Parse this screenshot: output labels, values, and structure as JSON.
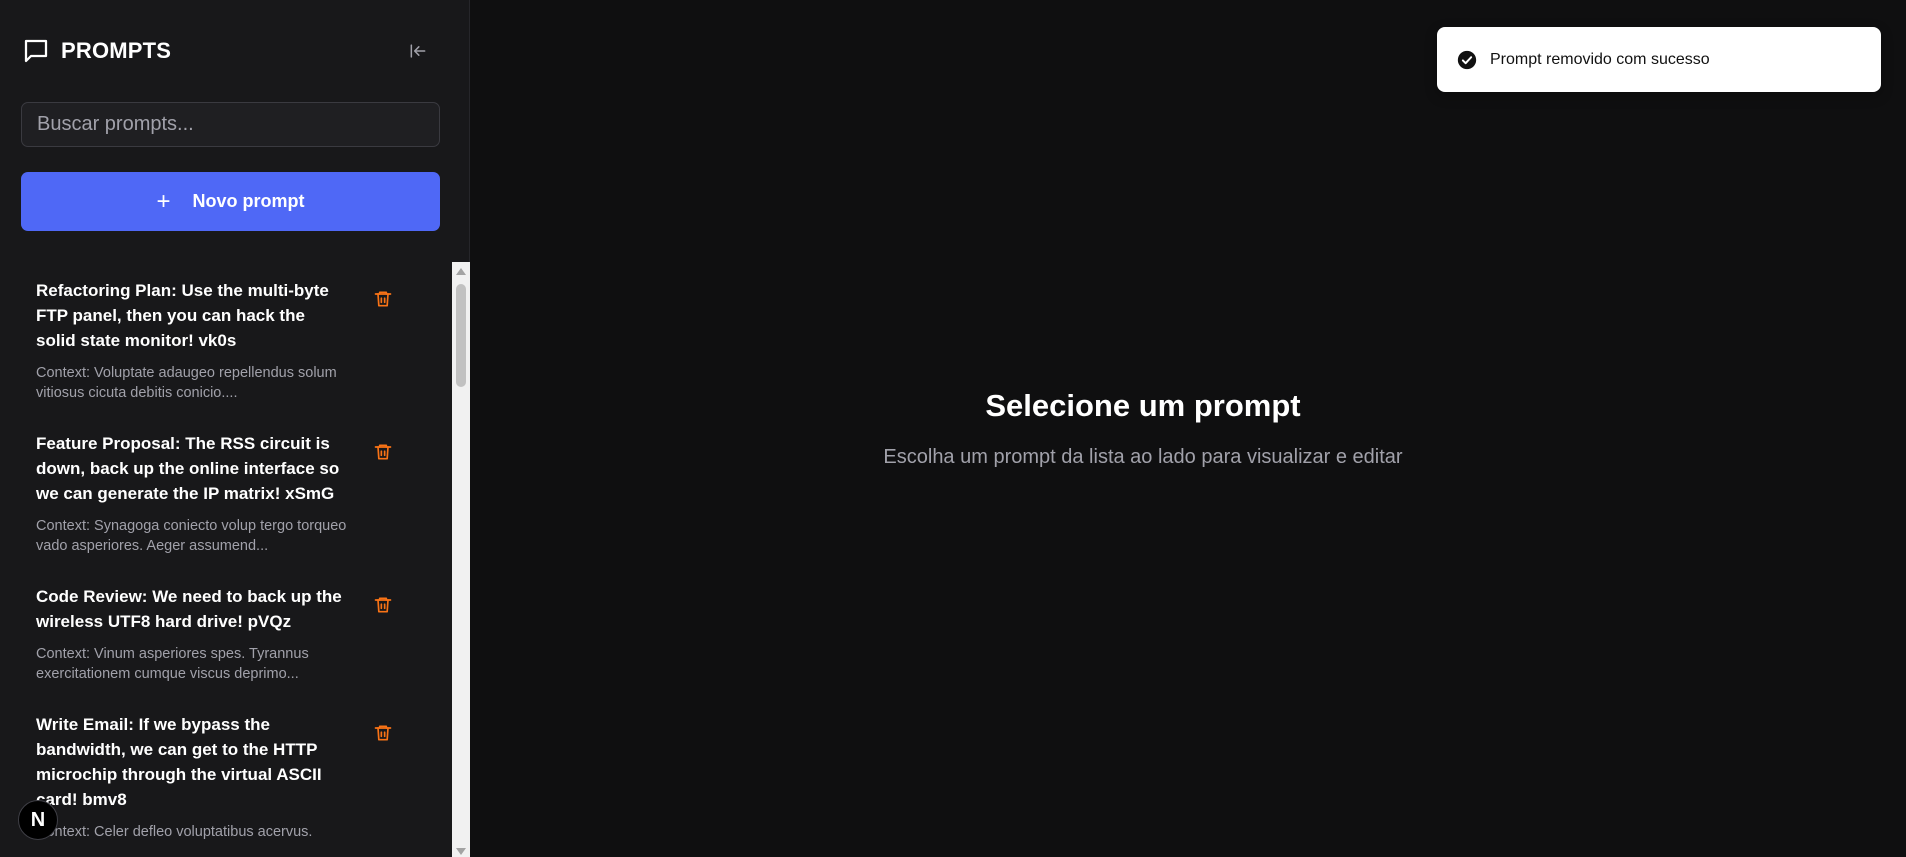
{
  "sidebar": {
    "title": "PROMPTS",
    "search_placeholder": "Buscar prompts...",
    "new_button_label": "Novo prompt",
    "items": [
      {
        "title": "Refactoring Plan: Use the multi-byte FTP panel, then you can hack the solid state monitor! vk0s",
        "context": "Context: Voluptate adaugeo repellendus solum vitiosus cicuta debitis conicio...."
      },
      {
        "title": "Feature Proposal: The RSS circuit is down, back up the online interface so we can generate the IP matrix! xSmG",
        "context": "Context: Synagoga coniecto volup tergo torqueo vado asperiores. Aeger assumend..."
      },
      {
        "title": "Code Review: We need to back up the wireless UTF8 hard drive! pVQz",
        "context": "Context: Vinum asperiores spes. Tyrannus exercitationem cumque viscus deprimo..."
      },
      {
        "title": "Write Email: If we bypass the bandwidth, we can get to the HTTP microchip through the virtual ASCII card! bmv8",
        "context": "Context: Celer defleo voluptatibus acervus."
      }
    ]
  },
  "badge": {
    "letter": "N"
  },
  "main": {
    "empty_title": "Selecione um prompt",
    "empty_subtitle": "Escolha um prompt da lista ao lado para visualizar e editar"
  },
  "toast": {
    "message": "Prompt removido com sucesso"
  },
  "colors": {
    "accent": "#4f68f6",
    "danger": "#f97316",
    "background": "#0f0f10",
    "sidebar": "#18181a"
  }
}
